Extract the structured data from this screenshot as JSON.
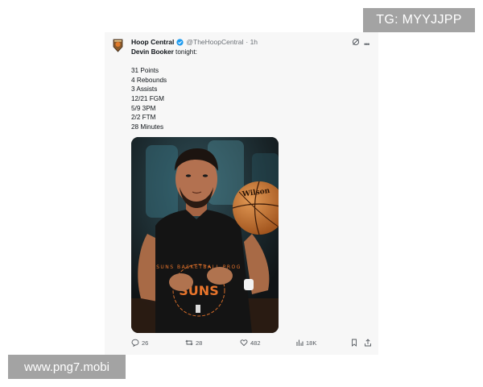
{
  "tweet": {
    "author_name": "Hoop Central",
    "handle": "@TheHoopCentral",
    "time": "· 1h",
    "verified_icon": "verified-badge-icon",
    "text_lead_bold": "Devin Booker",
    "text_lead_rest": " tonight:",
    "stats": [
      "31 Points",
      "4 Rebounds",
      "3 Assists",
      "12/21 FGM",
      "5/9 3PM",
      "2/2 FTM",
      "28 Minutes"
    ],
    "photo": {
      "jersey_ring_text": "SUNS BASKETBALL PROG",
      "jersey_center_text": "SUNS",
      "ball_brand": "Wilson"
    },
    "actions": {
      "replies": "26",
      "reposts": "28",
      "likes": "482",
      "views": "18K"
    }
  },
  "watermarks": {
    "top_right": "TG: MYYJJPP",
    "bottom_left": "www.png7.mobi"
  },
  "colors": {
    "verified_blue": "#1d9bf0",
    "watermark_gray": "#a3a3a3",
    "jersey_orange": "#e8742b"
  }
}
